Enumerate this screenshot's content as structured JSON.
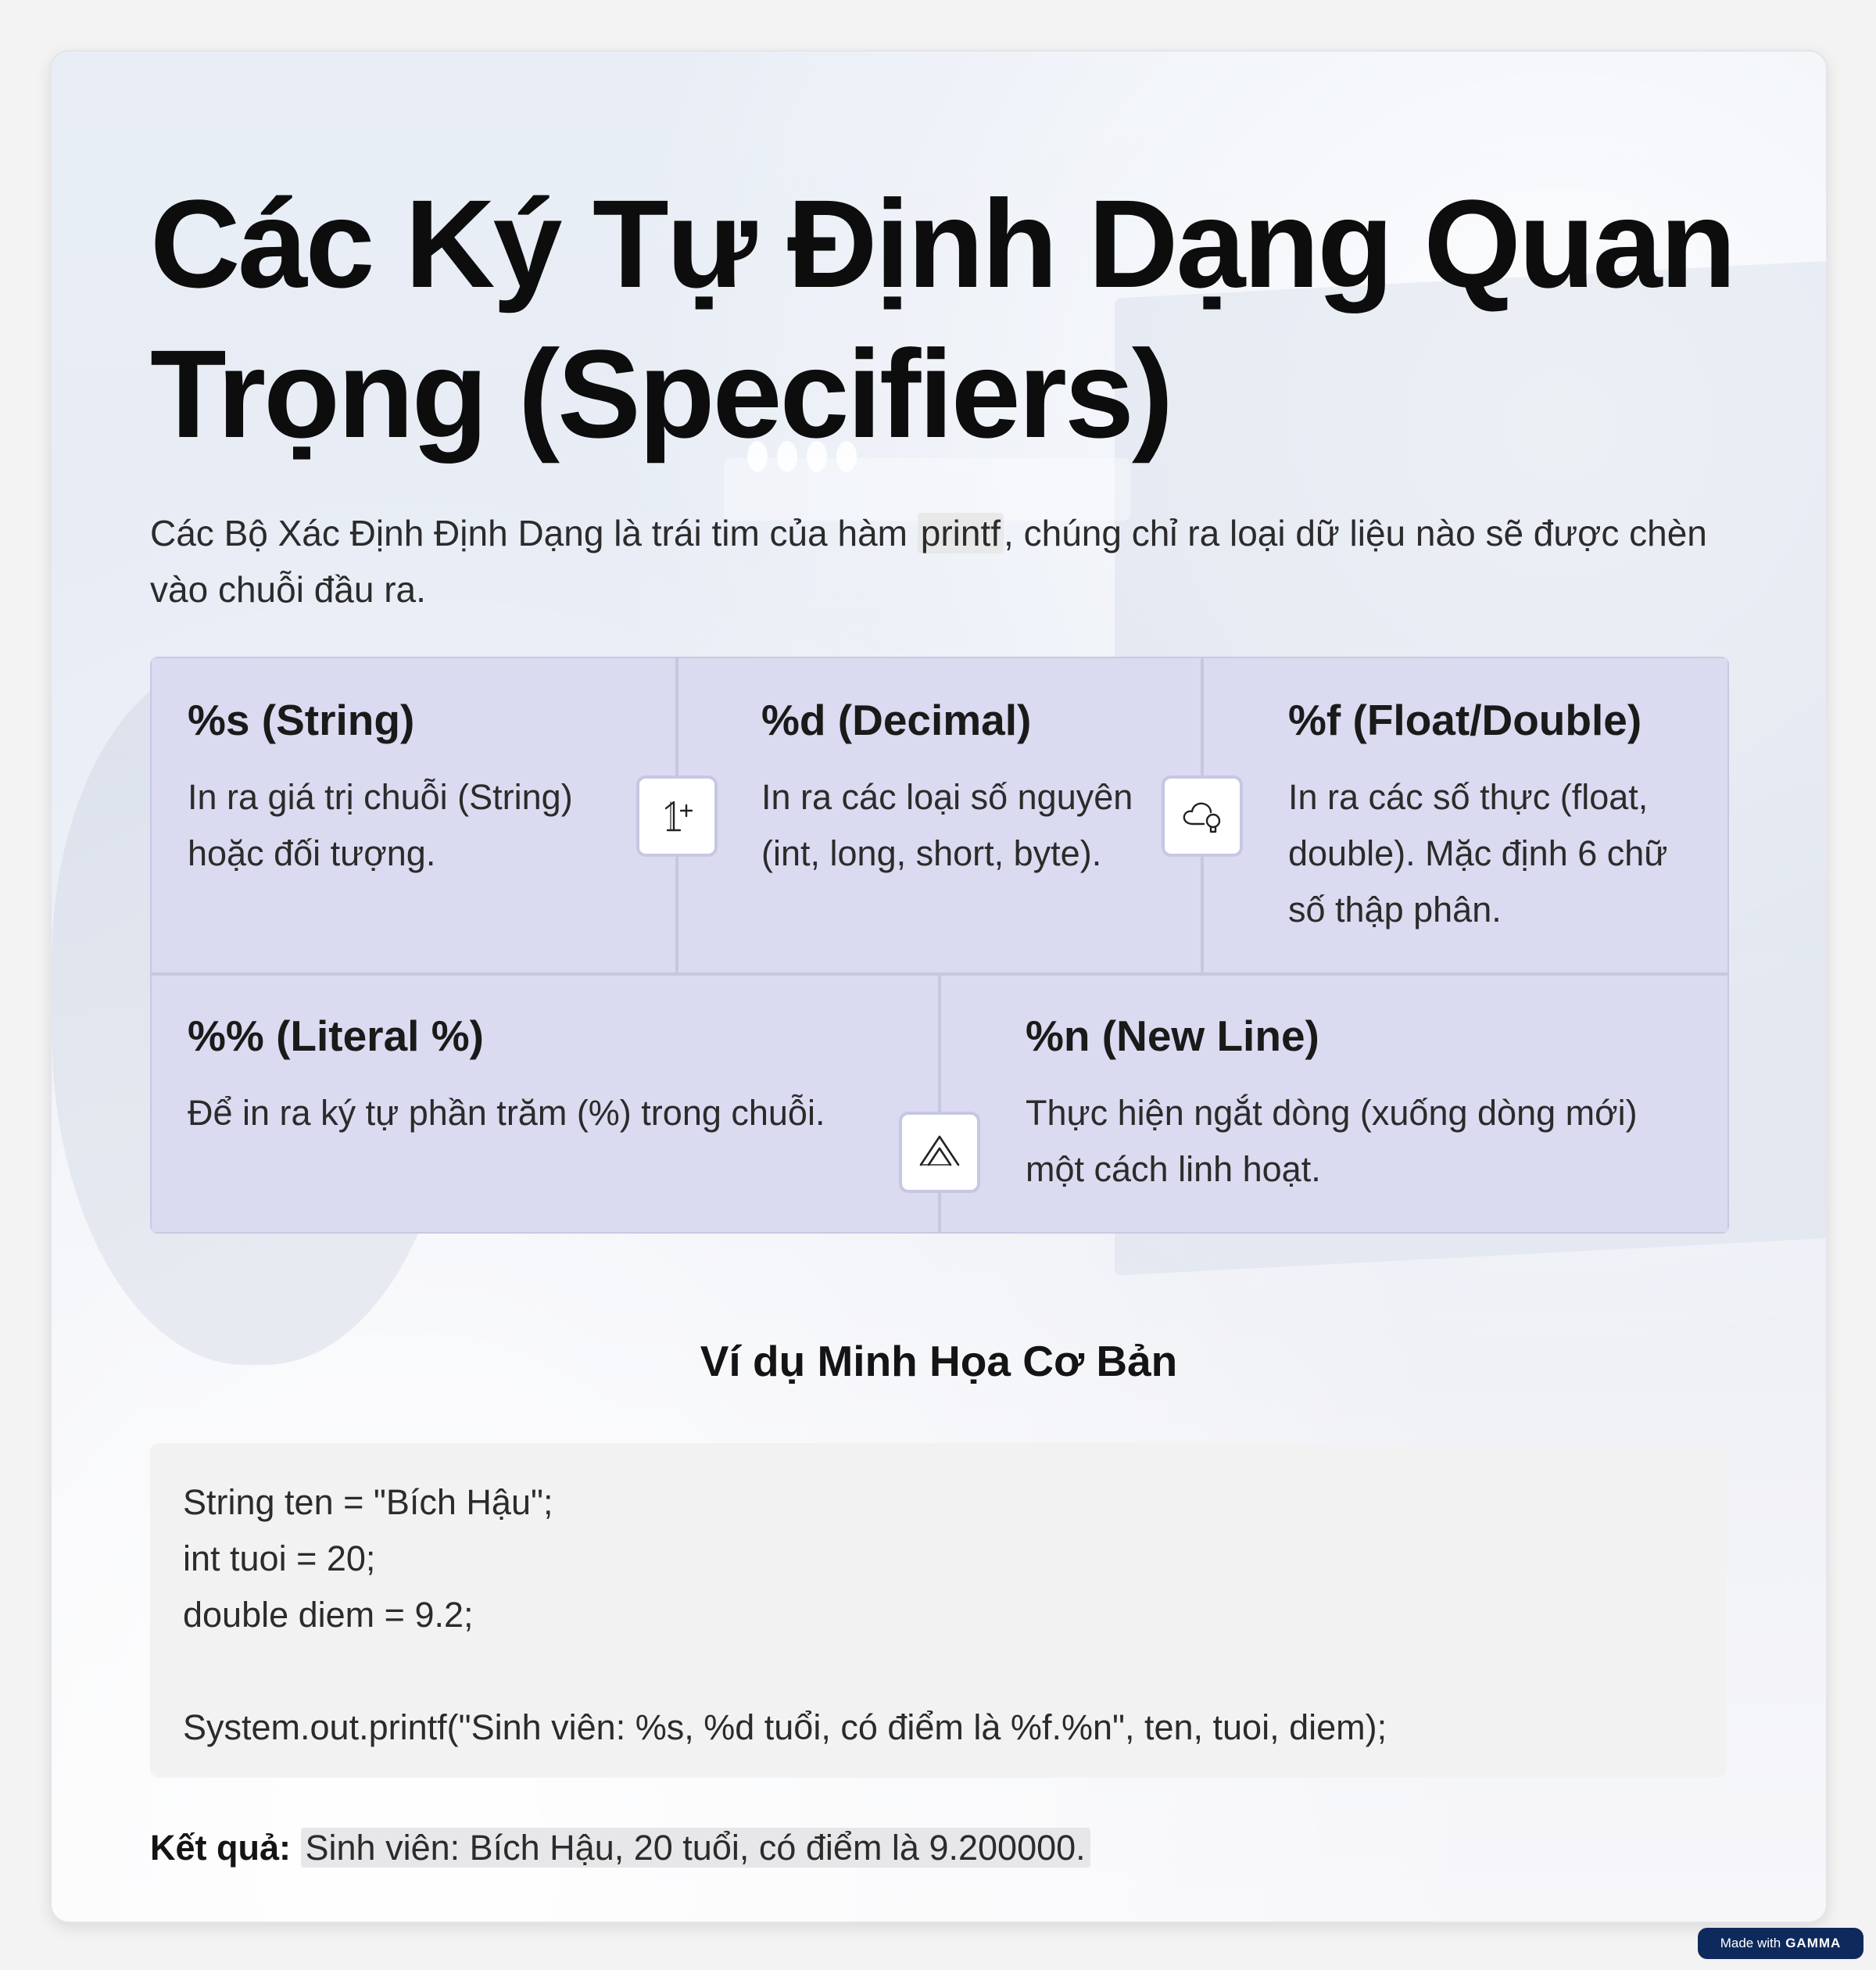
{
  "title": "Các Ký Tự Định Dạng Quan Trọng (Specifiers)",
  "intro": {
    "before": "Các Bộ Xác Định Định Dạng là trái tim của hàm ",
    "code": "printf",
    "after": ", chúng chỉ ra loại dữ liệu nào sẽ được chèn vào chuỗi đầu ra."
  },
  "specifiers": [
    {
      "title": "%s (String)",
      "description": "In ra giá trị chuỗi (String) hoặc đối tượng."
    },
    {
      "title": "%d (Decimal)",
      "description": "In ra các loại số nguyên (int, long, short, byte)."
    },
    {
      "title": "%f (Float/Double)",
      "description": "In ra các số thực (float, double). Mặc định 6 chữ số thập phân."
    },
    {
      "title": "%% (Literal %)",
      "description": "Để in ra ký tự phần trăm (%) trong chuỗi."
    },
    {
      "title": "%n (New Line)",
      "description": "Thực hiện ngắt dòng (xuống dòng mới) một cách linh hoạt."
    }
  ],
  "icons": [
    "number-one-plus-icon",
    "cloud-lightbulb-icon",
    "triangle-peak-icon"
  ],
  "example": {
    "heading": "Ví dụ Minh Họa Cơ Bản",
    "code_lines": [
      "String ten = \"Bích Hậu\";",
      "int tuoi = 20;",
      "double diem = 9.2;",
      "",
      "System.out.printf(\"Sinh viên: %s, %d tuổi, có điểm là %f.%n\", ten, tuoi, diem);"
    ],
    "result_label": "Kết quả:",
    "result_value": "Sinh viên: Bích Hậu, 20 tuổi, có điểm là 9.200000."
  },
  "badge": {
    "prefix": "Made with",
    "brand": "GAMMA"
  },
  "colors": {
    "cell_bg": "#dadaf0",
    "cell_border": "#c6c8e2",
    "code_bg": "#f2f2f2",
    "badge_bg": "#0e2a5c"
  }
}
